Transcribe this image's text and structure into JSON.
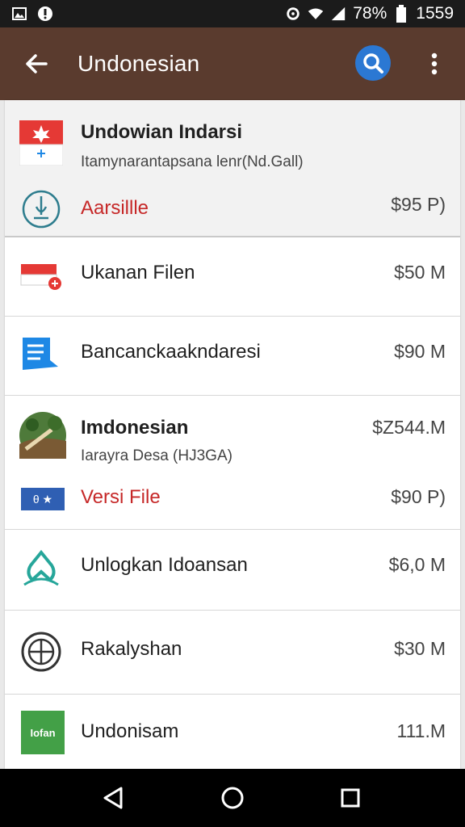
{
  "status_bar": {
    "battery": "78%",
    "time": "1559"
  },
  "app_bar": {
    "title": "Undonesian"
  },
  "items": [
    {
      "title": "Undowian Indarsi",
      "subtitle": "Itamynarantapsana lenr(Nd.Gall)",
      "sub_label": "Aarsillle",
      "size": "$95 P)"
    },
    {
      "title": "Ukanan Filen",
      "size": "$50 M"
    },
    {
      "title": "Bancanckaakndaresi",
      "size": "$90 M"
    },
    {
      "title": "Imdonesian",
      "subtitle": "Iarayra Desa (HJ3GA)",
      "size": "$Z544.M",
      "sub_label": "Versi File",
      "sub_size": "$90 P)",
      "badge": "θ ★"
    },
    {
      "title": "Unlogkan Idoansan",
      "size": "$6,0 M"
    },
    {
      "title": "Rakalyshan",
      "size": "$30 M"
    },
    {
      "title": "Undonisam",
      "size": "111.M",
      "icon_text": "Iofan"
    }
  ],
  "colors": {
    "app_bar": "#5a3b2e",
    "search_button": "#2b78d3",
    "accent_red": "#c62828"
  }
}
